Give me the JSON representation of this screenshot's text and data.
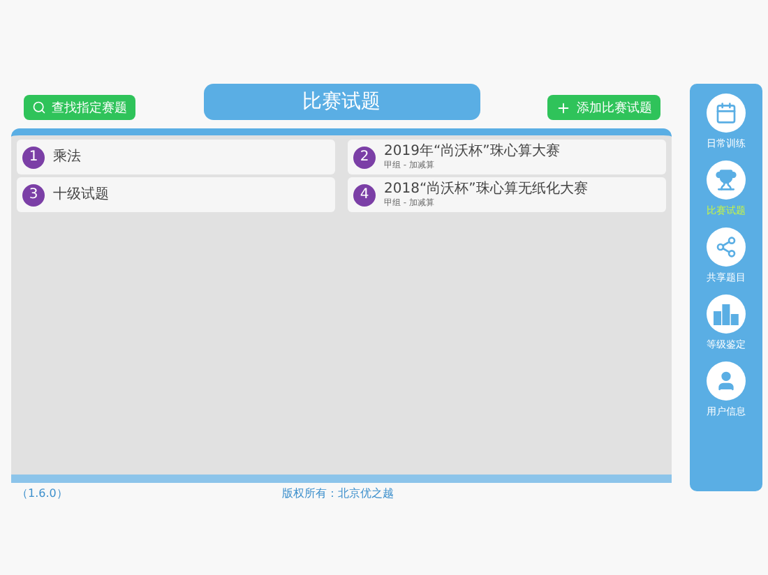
{
  "header": {
    "search_button": "查找指定赛题",
    "title": "比赛试题",
    "add_button": "添加比赛试题"
  },
  "items": [
    {
      "number": "1",
      "title": "乘法"
    },
    {
      "number": "2",
      "title": "2019年“尚沃杯”珠心算大赛",
      "subtitle": "甲组 - 加减算"
    },
    {
      "number": "3",
      "title": "十级试题"
    },
    {
      "number": "4",
      "title": "2018“尚沃杯”珠心算无纸化大赛",
      "subtitle": "甲组 - 加减算"
    }
  ],
  "footer": {
    "version": "（1.6.0）",
    "copyright": "版权所有：北京优之越"
  },
  "sidebar": {
    "items": [
      {
        "kind": "calendar",
        "label": "日常训练",
        "selected": false
      },
      {
        "kind": "trophy",
        "label": "比赛试题",
        "selected": true
      },
      {
        "kind": "share",
        "label": "共享题目",
        "selected": false
      },
      {
        "kind": "podium",
        "label": "等级鉴定",
        "selected": false
      },
      {
        "kind": "user",
        "label": "用户信息",
        "selected": false
      }
    ]
  }
}
